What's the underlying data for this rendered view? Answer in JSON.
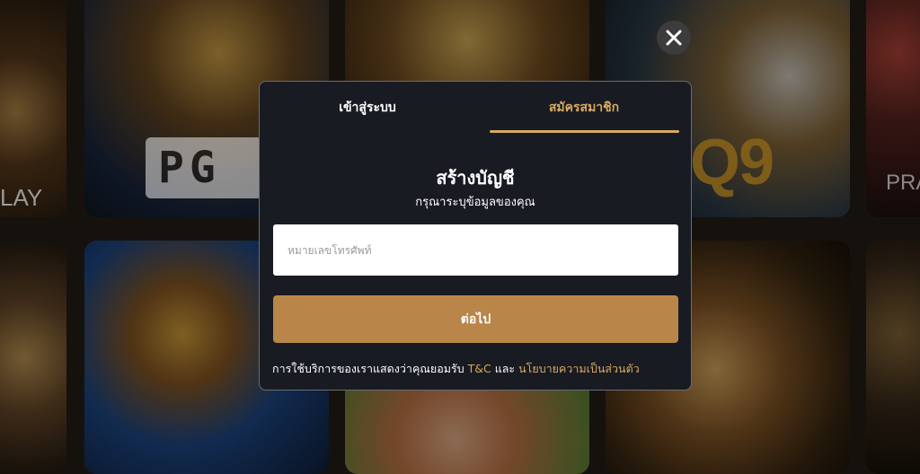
{
  "background": {
    "logos": {
      "pg": "PG",
      "play": "LAY",
      "q9": "Q9",
      "pra": "PRA"
    }
  },
  "close": {
    "icon": "close-icon"
  },
  "modal": {
    "tabs": [
      {
        "label": "เข้าสู่ระบบ",
        "active": false
      },
      {
        "label": "สมัครสมาชิก",
        "active": true
      }
    ],
    "title": "สร้างบัญชี",
    "subtitle": "กรุณาระบุข้อมูลของคุณ",
    "phone_input": {
      "placeholder": "หมายเลขโทรศัพท์",
      "value": ""
    },
    "next_label": "ต่อไป",
    "terms": {
      "prefix": "การใช้บริการของเราแสดงว่าคุณยอมรับ",
      "tc_link": "T&C",
      "conjunction": "และ",
      "privacy_link": "นโยบายความเป็นส่วนตัว"
    }
  },
  "colors": {
    "accent": "#d8a962",
    "button": "#b98548",
    "modal_bg": "#181b22"
  }
}
